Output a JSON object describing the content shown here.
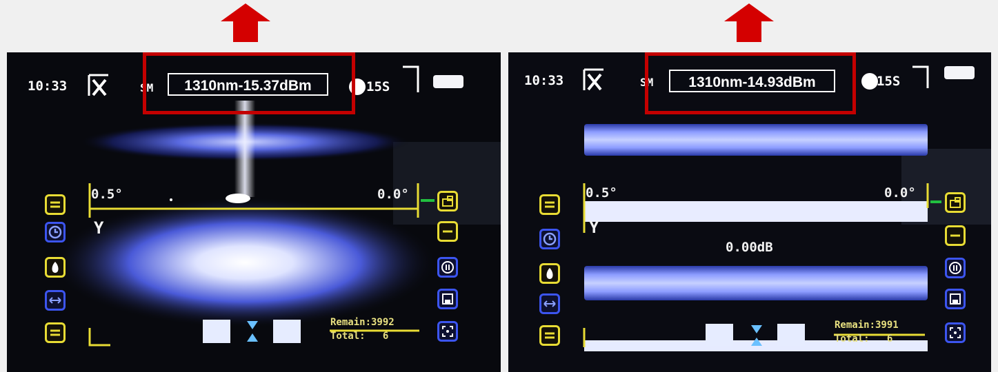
{
  "colors": {
    "highlight": "#c40000",
    "arrow": "#d40000",
    "yellow": "#e8dc34",
    "blue": "#3c55f0"
  },
  "panels": [
    {
      "time": "10:33",
      "mode_icon": "x-axis-icon",
      "fiber_mode": "SM",
      "power_readout": "1310nm-15.37dBm",
      "timer": "15S",
      "angle_left": "0.5°",
      "angle_right": "0.0°",
      "view_axis": "Y",
      "remain": "Remain:3992",
      "total": "Total:   6",
      "left_buttons": [
        "swap-icon",
        "clock-icon",
        "flame-icon",
        "arrows-icon",
        "menu-icon"
      ],
      "right_buttons": [
        "screen-icon",
        "menu-icon",
        "pause-icon",
        "save-icon",
        "focus-icon"
      ]
    },
    {
      "time": "10:33",
      "mode_icon": "x-axis-icon",
      "fiber_mode": "SM",
      "power_readout": "1310nm-14.93dBm",
      "timer": "15S",
      "angle_left": "0.5°",
      "angle_right": "0.0°",
      "view_axis": "Y",
      "splice_loss": "0.00dB",
      "remain": "Remain:3991",
      "total": "Total:   6",
      "left_buttons": [
        "swap-icon",
        "clock-icon",
        "flame-icon",
        "arrows-icon",
        "menu-icon"
      ],
      "right_buttons": [
        "screen-icon",
        "menu-icon",
        "pause-icon",
        "save-icon",
        "focus-icon"
      ]
    }
  ]
}
